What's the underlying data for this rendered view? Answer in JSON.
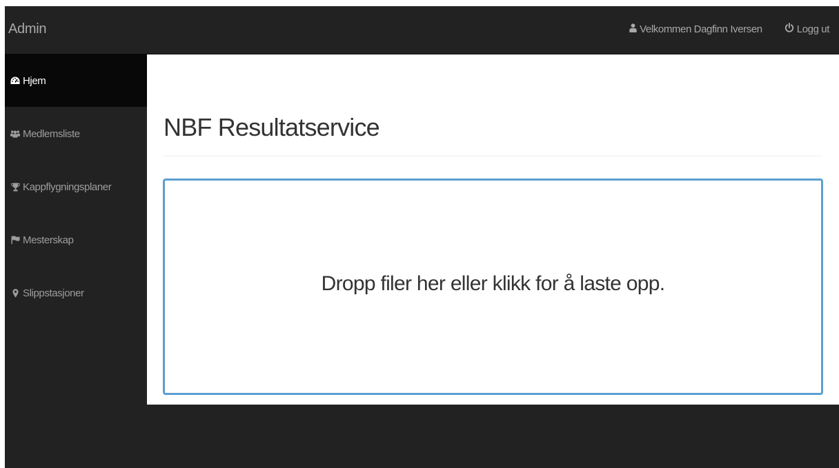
{
  "navbar": {
    "brand": "Admin",
    "welcome": "Velkommen Dagfinn Iversen",
    "welcome_icon": "user-icon",
    "logout": "Logg ut",
    "logout_icon": "power-icon"
  },
  "sidebar": {
    "items": [
      {
        "label": "Hjem",
        "icon": "dashboard-icon",
        "active": true
      },
      {
        "label": "Medlemsliste",
        "icon": "users-icon",
        "active": false
      },
      {
        "label": "Kappflygningsplaner",
        "icon": "trophy-icon",
        "active": false
      },
      {
        "label": "Mesterskap",
        "icon": "flag-icon",
        "active": false
      },
      {
        "label": "Slippstasjoner",
        "icon": "map-marker-icon",
        "active": false
      }
    ]
  },
  "main": {
    "title": "NBF Resultatservice",
    "dropzone_text": "Dropp filer her eller klikk for å laste opp."
  },
  "colors": {
    "navbar_bg": "#222222",
    "active_item_bg": "#080808",
    "dropzone_border": "#5a9fd0",
    "text_muted": "#9d9d9d"
  }
}
